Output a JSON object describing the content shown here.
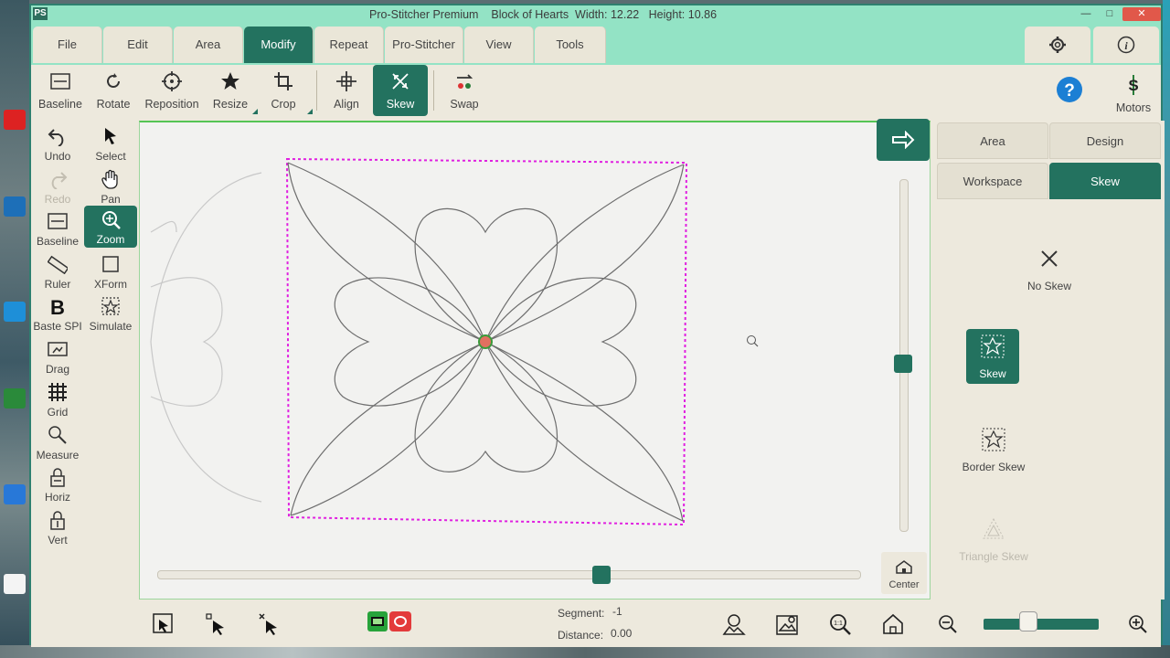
{
  "window": {
    "title": "Pro-Stitcher Premium    Block of Hearts  Width: 12.22   Height: 10.86",
    "logo": "PS"
  },
  "menu": {
    "tabs": [
      "File",
      "Edit",
      "Area",
      "Modify",
      "Repeat",
      "Pro-Stitcher",
      "View",
      "Tools"
    ],
    "active": "Modify",
    "icons": [
      "gear-icon",
      "info-icon"
    ]
  },
  "toolbar": {
    "tools": [
      "Baseline",
      "Rotate",
      "Reposition",
      "Resize",
      "Crop",
      "Align",
      "Skew",
      "Swap"
    ],
    "active": "Skew",
    "help_icon": "help-icon",
    "motors_label": "Motors",
    "motors_glyph": "S"
  },
  "sidebar": {
    "tools": [
      "Undo",
      "Select",
      "Redo",
      "Pan",
      "Baseline",
      "Zoom",
      "Ruler",
      "XForm",
      "Baste SPI",
      "Simulate",
      "Drag",
      "Grid",
      "Measure",
      "Horiz",
      "Vert"
    ],
    "active": "Zoom",
    "disabled": [
      "Redo"
    ]
  },
  "canvas": {
    "center_label": "Center"
  },
  "right_panel": {
    "tabs": [
      "Area",
      "Design",
      "Workspace",
      "Skew"
    ],
    "active_tab": "Skew",
    "options": [
      "No Skew",
      "Skew",
      "Border Skew",
      "Triangle Skew"
    ],
    "active_option": "Skew",
    "disabled_options": [
      "Triangle Skew"
    ]
  },
  "status": {
    "segment_label": "Segment:",
    "segment_value": "-1",
    "distance_label": "Distance:",
    "distance_value": "0.00"
  },
  "colors": {
    "accent": "#23725f",
    "titlebar": "#93e3c5",
    "selection": "#e020e0"
  }
}
